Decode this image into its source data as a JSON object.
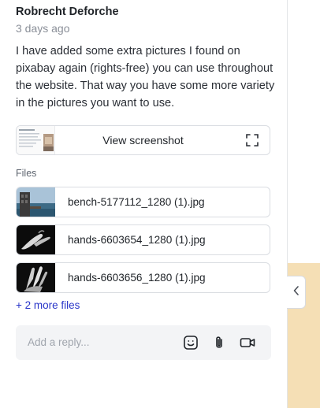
{
  "comment": {
    "author": "Robrecht Deforche",
    "time": "3 days ago",
    "message": "I have added some extra pictures I found on pixabay again (rights-free) you can use throughout the website. That way you have some more variety in the pictures you want to use."
  },
  "screenshot": {
    "label": "View screenshot",
    "icon": "expand-icon"
  },
  "files": {
    "heading": "Files",
    "items": [
      {
        "name": "bench-5177112_1280 (1).jpg"
      },
      {
        "name": "hands-6603654_1280 (1).jpg"
      },
      {
        "name": "hands-6603656_1280 (1).jpg"
      }
    ],
    "more_label": "+ 2 more files"
  },
  "reply": {
    "placeholder": "Add a reply...",
    "icons": [
      "emoji-icon",
      "paperclip-icon",
      "video-camera-icon"
    ]
  },
  "colors": {
    "link": "#2a36c9",
    "side_panel": "#f5dfb5",
    "reply_background": "#f3f4f6"
  }
}
